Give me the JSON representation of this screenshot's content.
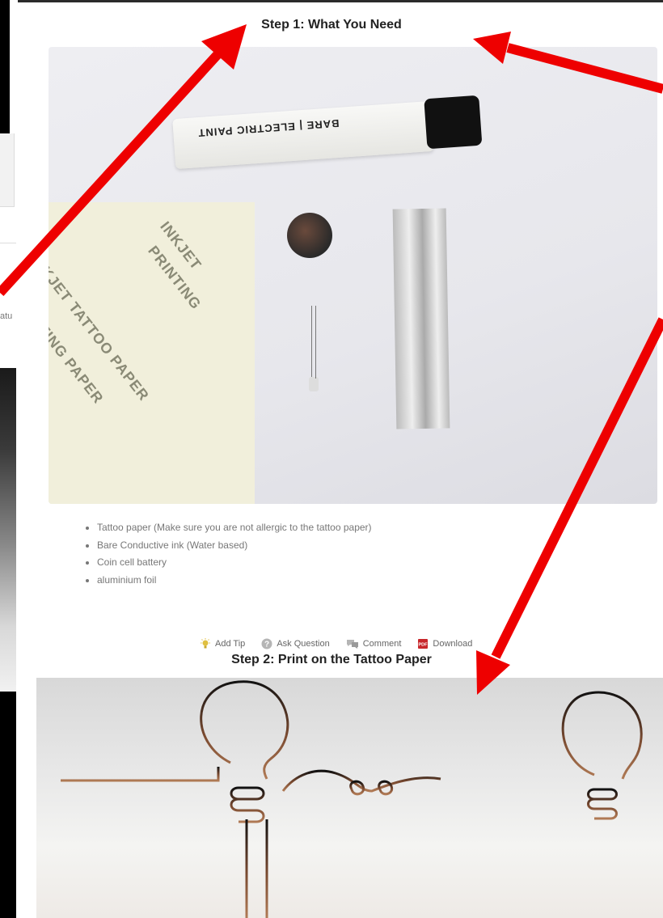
{
  "left_snippet": {
    "text": "atu"
  },
  "step1": {
    "title": "Step 1: What You Need",
    "tube_text": "BARE | ELECTRIC PAINT",
    "paper_text_1": "INKJET TATTOO PAPER",
    "paper_text_2": "PRINTING PAPER",
    "paper_text_3": "INKJET",
    "paper_text_4": "PRINTING",
    "items": [
      "Tattoo paper (Make sure you are not allergic to the tattoo paper)",
      "Bare Conductive ink (Water based)",
      "Coin cell battery",
      "aluminium foil"
    ]
  },
  "actions": {
    "add_tip": "Add Tip",
    "ask_question": "Ask Question",
    "comment": "Comment",
    "download": "Download"
  },
  "step2": {
    "title": "Step 2: Print on the Tattoo Paper"
  },
  "colors": {
    "arrow": "#ee0000",
    "title": "#222222",
    "text": "#777777"
  }
}
